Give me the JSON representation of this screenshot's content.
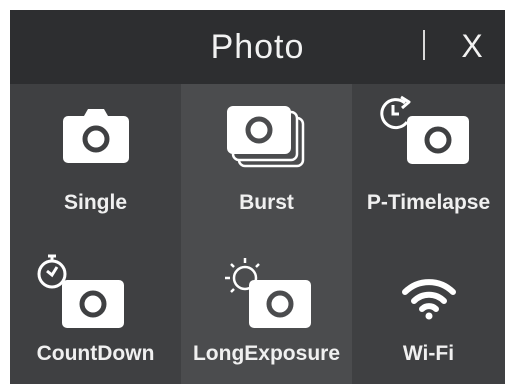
{
  "header": {
    "title": "Photo",
    "close_label": "X"
  },
  "modes": [
    {
      "id": "single",
      "label": "Single",
      "icon": "camera-icon"
    },
    {
      "id": "burst",
      "label": "Burst",
      "icon": "burst-camera-icon"
    },
    {
      "id": "p-timelapse",
      "label": "P-Timelapse",
      "icon": "timelapse-camera-icon"
    },
    {
      "id": "countdown",
      "label": "CountDown",
      "icon": "countdown-camera-icon"
    },
    {
      "id": "longexposure",
      "label": "LongExposure",
      "icon": "long-exposure-camera-icon"
    },
    {
      "id": "wifi",
      "label": "Wi-Fi",
      "icon": "wifi-icon"
    }
  ],
  "colors": {
    "header_bg": "#2d2e30",
    "cell_light": "#4b4c4e",
    "cell_dark": "#3f4042",
    "icon": "#ffffff"
  }
}
